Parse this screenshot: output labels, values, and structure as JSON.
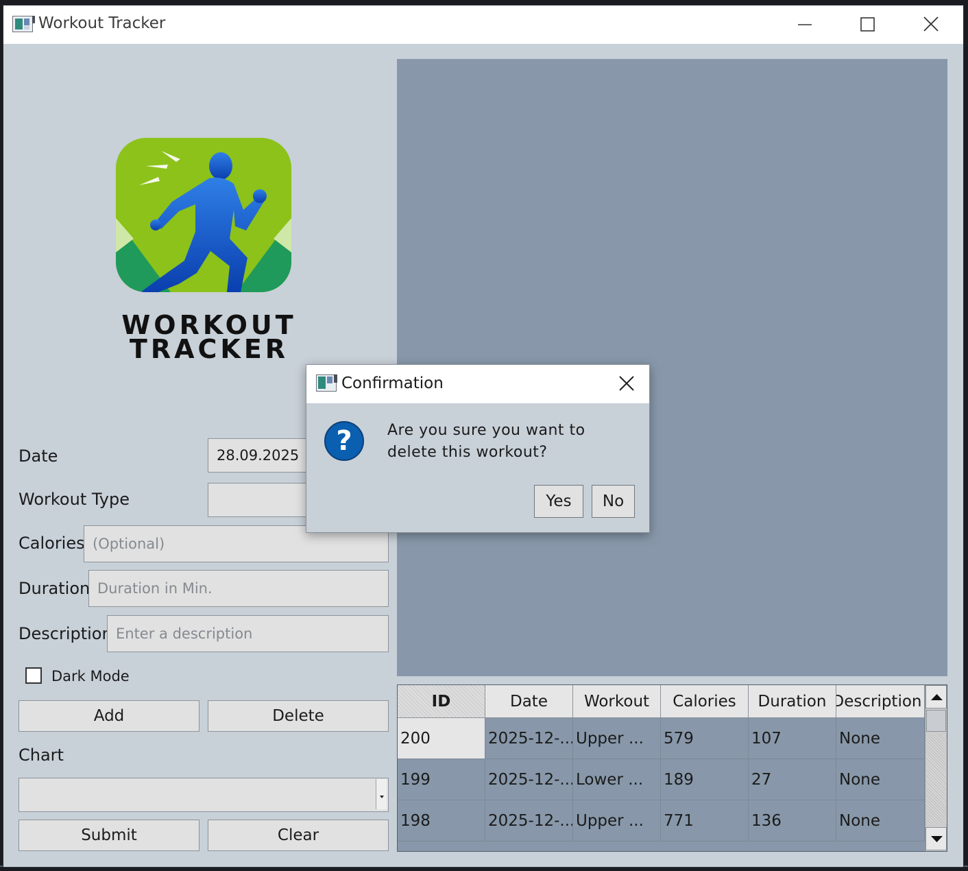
{
  "window": {
    "title": "Workout Tracker"
  },
  "logo": {
    "line1": "WORKOUT",
    "line2": "TRACKER"
  },
  "form": {
    "date_label": "Date",
    "date_value": "28.09.2025",
    "workout_type_label": "Workout Type",
    "workout_type_value": "",
    "calories_label": "Calories",
    "calories_placeholder": "(Optional)",
    "duration_label": "Duration",
    "duration_placeholder": "Duration in Min.",
    "description_label": "Description",
    "description_placeholder": "Enter a description",
    "dark_mode_label": "Dark Mode",
    "dark_mode_checked": false,
    "add_label": "Add",
    "delete_label": "Delete",
    "chart_label": "Chart",
    "chart_value": "",
    "submit_label": "Submit",
    "clear_label": "Clear"
  },
  "table": {
    "headers": [
      "ID",
      "Date",
      "Workout",
      "Calories",
      "Duration",
      "Description"
    ],
    "rows": [
      [
        "200",
        "2025-12-...",
        "Upper ...",
        "579",
        "107",
        "None"
      ],
      [
        "199",
        "2025-12-...",
        "Lower ...",
        "189",
        "27",
        "None"
      ],
      [
        "198",
        "2025-12-...",
        "Upper ...",
        "771",
        "136",
        "None"
      ]
    ]
  },
  "dialog": {
    "title": "Confirmation",
    "message": "Are you sure you want to delete this workout?",
    "yes_label": "Yes",
    "no_label": "No"
  },
  "icons": {
    "minimize": "minimize-icon",
    "maximize": "maximize-icon",
    "close": "close-icon",
    "question": "question-icon"
  },
  "colors": {
    "window_bg": "#c8d0d8",
    "chart_bg": "#8898aa",
    "question_icon": "#0a5fb0",
    "logo_green": "#8cc21a",
    "logo_runner": "#1f5fd0"
  }
}
